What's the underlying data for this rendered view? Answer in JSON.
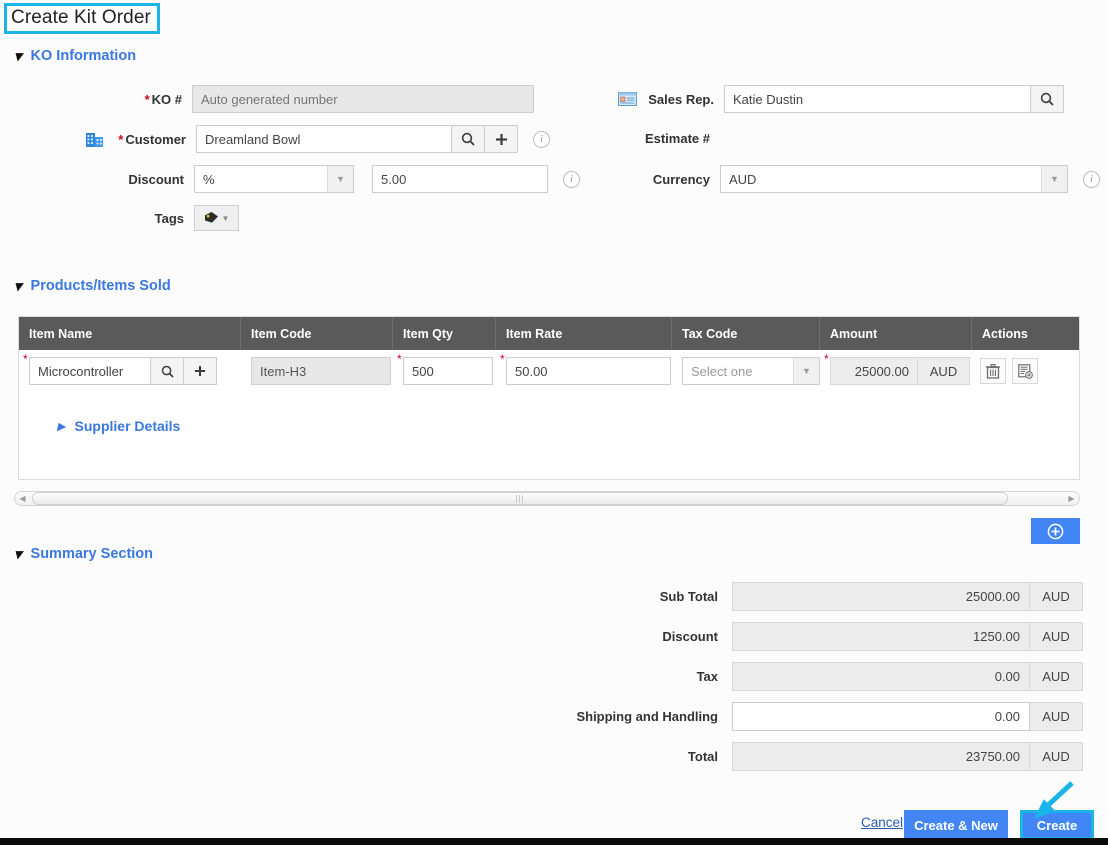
{
  "page": {
    "title": "Create Kit Order"
  },
  "sections": {
    "ko_information": {
      "label": "KO Information",
      "expanded": true
    },
    "products": {
      "label": "Products/Items Sold",
      "expanded": true
    },
    "summary": {
      "label": "Summary Section",
      "expanded": true
    },
    "supplier_details": {
      "label": "Supplier Details",
      "expanded": false
    }
  },
  "ko_information": {
    "ko_number": {
      "label": "KO #",
      "required": true,
      "placeholder": "Auto generated number",
      "value": "",
      "readonly": true
    },
    "customer": {
      "label": "Customer",
      "required": true,
      "value": "Dreamland Bowl",
      "icon": "office-building-icon",
      "search_icon": "search-icon",
      "add_icon": "plus-icon",
      "info_icon": "info-icon"
    },
    "discount": {
      "label": "Discount",
      "type_value": "%",
      "amount_value": "5.00",
      "info_icon": "info-icon"
    },
    "tags": {
      "label": "Tags",
      "icon": "tag-icon",
      "caret": "chevron-down-icon"
    },
    "sales_rep": {
      "label": "Sales Rep.",
      "value": "Katie Dustin",
      "icon": "contact-card-icon",
      "search_icon": "search-icon"
    },
    "estimate_number": {
      "label": "Estimate #",
      "value": ""
    },
    "currency": {
      "label": "Currency",
      "value": "AUD",
      "info_icon": "info-icon"
    }
  },
  "products_table": {
    "columns": [
      "Item Name",
      "Item Code",
      "Item Qty",
      "Item Rate",
      "Tax Code",
      "Amount",
      "Actions"
    ],
    "rows": [
      {
        "item_name": "Microcontroller",
        "item_code": "Item-H3",
        "item_qty": "500",
        "item_rate": "50.00",
        "tax_code_placeholder": "Select one",
        "amount": "25000.00",
        "amount_currency": "AUD",
        "delete_icon": "trash-icon",
        "duplicate_icon": "copy-row-icon"
      }
    ],
    "add_row_button": {
      "icon": "circle-plus-icon"
    },
    "scrollbar": {
      "left_arrow": "chevron-left-icon",
      "right_arrow": "chevron-right-icon",
      "grip": "‖"
    }
  },
  "summary": {
    "rows": [
      {
        "label": "Sub Total",
        "value": "25000.00",
        "currency": "AUD",
        "editable": false
      },
      {
        "label": "Discount",
        "value": "1250.00",
        "currency": "AUD",
        "editable": false
      },
      {
        "label": "Tax",
        "value": "0.00",
        "currency": "AUD",
        "editable": false
      },
      {
        "label": "Shipping and Handling",
        "value": "0.00",
        "currency": "AUD",
        "editable": true
      },
      {
        "label": "Total",
        "value": "23750.00",
        "currency": "AUD",
        "editable": false
      }
    ]
  },
  "footer": {
    "cancel_label": "Cancel",
    "create_new_label": "Create & New",
    "create_label": "Create"
  },
  "annotations": {
    "highlight_color": "#1ab4e8",
    "accent_color": "#4285f4",
    "link_color": "#3a78e0",
    "required_color": "#d0021b",
    "title_highlighted": true,
    "create_button_highlighted": true,
    "arrow_points_to": "Create"
  }
}
